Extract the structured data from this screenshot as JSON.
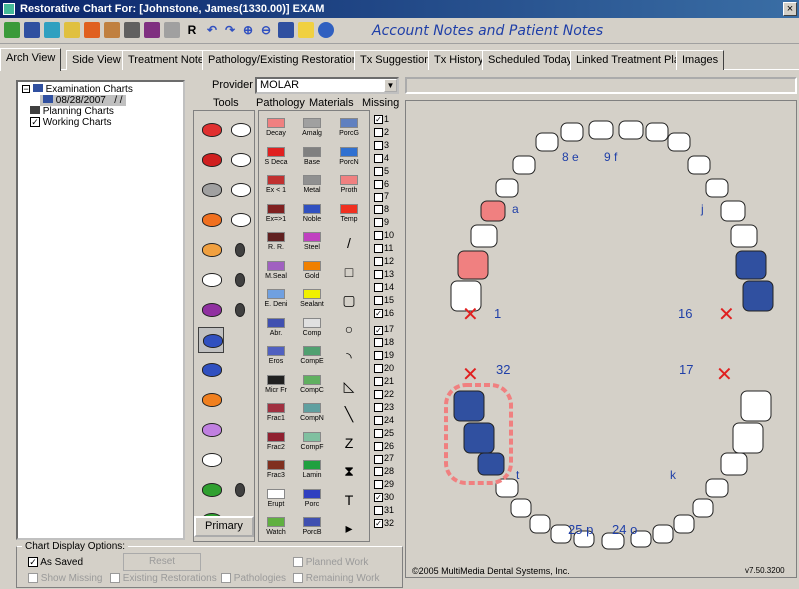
{
  "window": {
    "title": "Restorative Chart For:  [Johnstone, James(1330.00)] EXAM",
    "close_label": "×"
  },
  "toolbar": {
    "title": "Account Notes and Patient Notes",
    "r_label": "R"
  },
  "tabs": [
    "Arch View",
    "Side View",
    "Treatment Notes",
    "Pathology/Existing Restorations",
    "Tx Suggestions",
    "Tx History",
    "Scheduled Today",
    "Linked Treatment Plan",
    "Images"
  ],
  "tree": {
    "examination": "Examination Charts",
    "exam_date": "08/28/2007",
    "exam_suffix": "/ /",
    "planning": "Planning Charts",
    "working": "Working Charts"
  },
  "provider": {
    "label": "Provider :",
    "value": "MOLAR"
  },
  "columns": {
    "tools": "Tools",
    "pathology": "Pathology",
    "materials": "Materials",
    "missing": "Missing"
  },
  "pathology": [
    {
      "label": "Decay",
      "color": "#f08080"
    },
    {
      "label": "S Deca",
      "color": "#e02020"
    },
    {
      "label": "Ex < 1",
      "color": "#c03030"
    },
    {
      "label": "Ex=>1",
      "color": "#802020"
    },
    {
      "label": "R. R.",
      "color": "#602020"
    },
    {
      "label": "M.Seal",
      "color": "#a060c0"
    },
    {
      "label": "E. Deni",
      "color": "#70a0e0"
    },
    {
      "label": "Abr.",
      "color": "#4050b0"
    },
    {
      "label": "Eros",
      "color": "#5060c0"
    },
    {
      "label": "Micr Fr",
      "color": "#202020"
    },
    {
      "label": "Frac1",
      "color": "#a03040"
    },
    {
      "label": "Frac2",
      "color": "#902030"
    },
    {
      "label": "Frac3",
      "color": "#803020"
    },
    {
      "label": "Erupt",
      "color": "#ffffff"
    },
    {
      "label": "Watch",
      "color": "#60b040"
    }
  ],
  "materials": [
    {
      "label": "Amalg",
      "color": "#a0a0a0"
    },
    {
      "label": "Base",
      "color": "#808080"
    },
    {
      "label": "Metal",
      "color": "#909090"
    },
    {
      "label": "Noble",
      "color": "#3050c0"
    },
    {
      "label": "Steel",
      "color": "#c040c0"
    },
    {
      "label": "Gold",
      "color": "#f08000"
    },
    {
      "label": "Sealant",
      "color": "#f0f000"
    },
    {
      "label": "Comp",
      "color": "#e0e0e0"
    },
    {
      "label": "CompE",
      "color": "#50a070"
    },
    {
      "label": "CompC",
      "color": "#60b060"
    },
    {
      "label": "CompN",
      "color": "#60a0a0"
    },
    {
      "label": "CompF",
      "color": "#80c0a0"
    },
    {
      "label": "Lamin",
      "color": "#20a040"
    },
    {
      "label": "Porc",
      "color": "#3040c0"
    },
    {
      "label": "PorcB",
      "color": "#4050b0"
    }
  ],
  "materials_extra": [
    {
      "label": "PorcG",
      "color": "#6080c0"
    },
    {
      "label": "PorcN",
      "color": "#3070d0"
    },
    {
      "label": "Proth",
      "color": "#f08080"
    },
    {
      "label": "Temp",
      "color": "#f03020"
    }
  ],
  "missing": [
    {
      "n": "1",
      "checked": true
    },
    {
      "n": "2",
      "checked": false
    },
    {
      "n": "3",
      "checked": false
    },
    {
      "n": "4",
      "checked": false
    },
    {
      "n": "5",
      "checked": false
    },
    {
      "n": "6",
      "checked": false
    },
    {
      "n": "7",
      "checked": false
    },
    {
      "n": "8",
      "checked": false
    },
    {
      "n": "9",
      "checked": false
    },
    {
      "n": "10",
      "checked": false
    },
    {
      "n": "11",
      "checked": false
    },
    {
      "n": "12",
      "checked": false
    },
    {
      "n": "13",
      "checked": false
    },
    {
      "n": "14",
      "checked": false
    },
    {
      "n": "15",
      "checked": false
    },
    {
      "n": "16",
      "checked": true
    },
    {
      "n": "17",
      "checked": true
    },
    {
      "n": "18",
      "checked": false
    },
    {
      "n": "19",
      "checked": false
    },
    {
      "n": "20",
      "checked": false
    },
    {
      "n": "21",
      "checked": false
    },
    {
      "n": "22",
      "checked": false
    },
    {
      "n": "23",
      "checked": false
    },
    {
      "n": "24",
      "checked": false
    },
    {
      "n": "25",
      "checked": false
    },
    {
      "n": "26",
      "checked": false
    },
    {
      "n": "27",
      "checked": false
    },
    {
      "n": "28",
      "checked": false
    },
    {
      "n": "29",
      "checked": false
    },
    {
      "n": "30",
      "checked": true
    },
    {
      "n": "31",
      "checked": false
    },
    {
      "n": "32",
      "checked": true
    }
  ],
  "primary_label": "Primary",
  "arch_labels": {
    "l8e": "8 e",
    "l9f": "9 f",
    "la": "a",
    "lj": "j",
    "l1": "1",
    "l16": "16",
    "l32": "32",
    "l17": "17",
    "lt": "t",
    "lk": "k",
    "l25p": "25 p",
    "l24o": "24 o",
    "x_mark": "✕"
  },
  "colors": {
    "arch_blue": "#3050a0",
    "decay": "#f08080",
    "missing_x": "#e02020"
  },
  "copyright": "©2005 MultiMedia Dental Systems, Inc.",
  "version": "v7.50.3200",
  "options": {
    "title": "Chart Display Options:",
    "as_saved": "As Saved",
    "reset": "Reset",
    "planned": "Planned Work",
    "show_missing": "Show Missing",
    "existing": "Existing Restorations",
    "pathologies": "Pathologies",
    "remaining": "Remaining Work"
  }
}
